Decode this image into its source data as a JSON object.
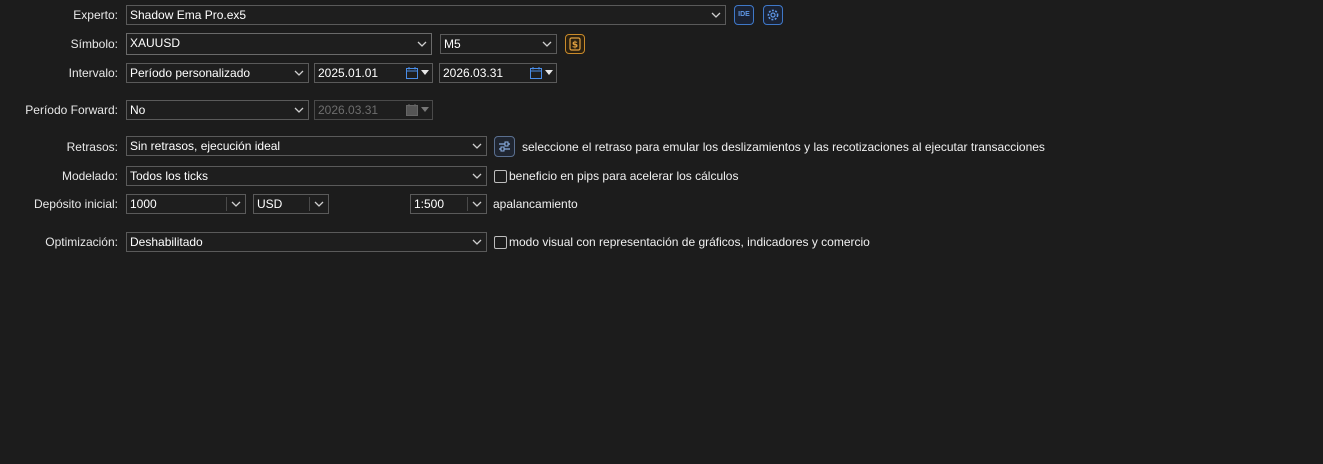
{
  "labels": {
    "expert": "Experto:",
    "symbol": "Símbolo:",
    "interval": "Intervalo:",
    "forward": "Período Forward:",
    "delays": "Retrasos:",
    "modeling": "Modelado:",
    "deposit": "Depósito inicial:",
    "optimization": "Optimización:"
  },
  "fields": {
    "expert": "Shadow Ema Pro.ex5",
    "symbol": "XAUUSD",
    "timeframe": "M5",
    "interval": "Período personalizado",
    "date_from": "2025.01.01",
    "date_to": "2026.03.31",
    "forward": "No",
    "forward_date": "2026.03.31",
    "delays": "Sin retrasos, ejecución ideal",
    "modeling": "Todos los ticks",
    "deposit": "1000",
    "currency": "USD",
    "leverage": "1:500",
    "optimization": "Deshabilitado"
  },
  "texts": {
    "delays_hint": "seleccione el retraso para emular los deslizamientos y las recotizaciones al ejecutar transacciones",
    "pips_label": "beneficio en pips para acelerar los cálculos",
    "leverage_label": "apalancamiento",
    "visual_label": "modo visual con representación de gráficos, indicadores y comercio"
  },
  "buttons": {
    "ide": "IDE"
  },
  "checkboxes": {
    "pips": false,
    "visual": false
  },
  "icons": {
    "ide": "ide-icon",
    "settings": "gear-icon",
    "symbol_spec": "dollar-icon",
    "delays_settings": "sliders-icon",
    "calendar": "calendar-icon",
    "chevron": "chevron-down-icon"
  },
  "colors": {
    "background": "#1c1c1c",
    "accent_blue": "#3f78c8",
    "accent_gold": "#c98a2a"
  }
}
